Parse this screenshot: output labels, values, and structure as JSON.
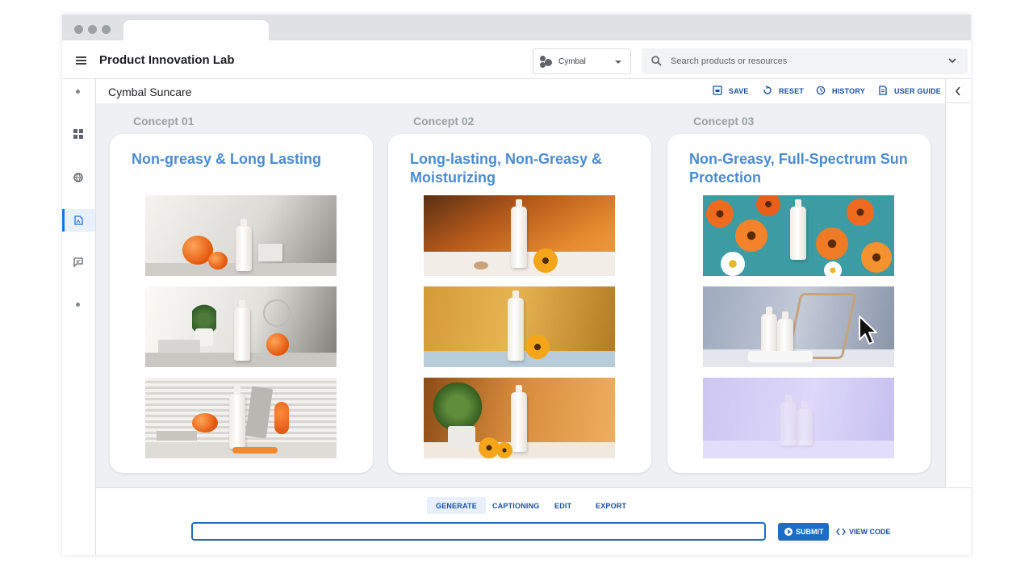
{
  "app": {
    "title": "Product Innovation Lab"
  },
  "brand_select": {
    "value": "Cymbal",
    "icon": "cymbal-logo-icon"
  },
  "search": {
    "placeholder": "Search products or resources"
  },
  "project": {
    "title": "Cymbal Suncare"
  },
  "actions": {
    "save": "SAVE",
    "reset": "RESET",
    "history": "HISTORY",
    "user_guide": "USER GUIDE"
  },
  "rail": {
    "items": [
      {
        "icon": "dot-icon"
      },
      {
        "icon": "grid-icon"
      },
      {
        "icon": "globe-icon"
      },
      {
        "icon": "image-file-icon",
        "active": true
      },
      {
        "icon": "feedback-icon"
      },
      {
        "icon": "dot-icon"
      }
    ]
  },
  "concepts": [
    {
      "label": "Concept 01",
      "title": "Non-greasy & Long Lasting",
      "images": [
        "suncare bottle with pumpkins on white shelf",
        "suncare bottle with plant and orange",
        "suncare bottle by window blinds with pumpkin"
      ]
    },
    {
      "label": "Concept 02",
      "title": "Long-lasting, Non-Greasy & Moisturizing",
      "images": [
        "suncare bottle with sunflower on orange",
        "suncare bottle with sunflower on golden background",
        "suncare bottle with plant and sunflowers"
      ]
    },
    {
      "label": "Concept 03",
      "title": "Non-Greasy, Full-Spectrum Sun Protection",
      "images": [
        "suncare bottle among orange flowers on teal",
        "suncare bottles by lounge chair",
        "faded suncare bottles on lavender"
      ]
    }
  ],
  "bottom_tabs": {
    "generate": "GENERATE",
    "captioning": "CAPTIONING",
    "edit": "EDIT",
    "export": "EXPORT"
  },
  "prompt": {
    "value": ""
  },
  "submit_label": "SUBMIT",
  "view_code_label": "VIEW CODE",
  "colors": {
    "accent": "#1f6cc4",
    "concept_title": "#4a8bd1",
    "canvas_bg": "#eef0f3"
  }
}
